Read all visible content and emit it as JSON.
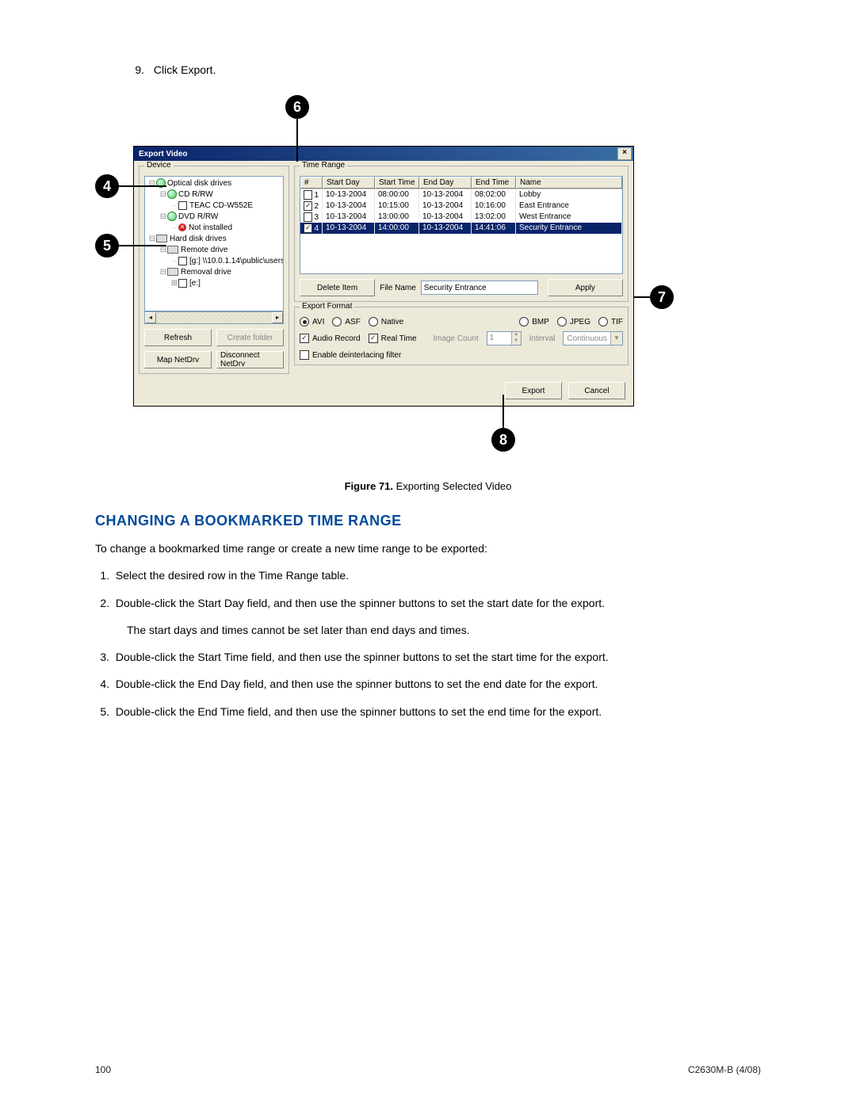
{
  "doc": {
    "step9": {
      "num": "9.",
      "text": "Click Export."
    },
    "heading": "CHANGING A BOOKMARKED TIME RANGE",
    "intro": "To change a bookmarked time range or create a new time range to be exported:",
    "steps": [
      {
        "n": "1.",
        "t": "Select the desired row in the Time Range table."
      },
      {
        "n": "2.",
        "t": "Double-click the Start Day field, and then use the spinner buttons to set the start date for the export.",
        "sub": "The start days and times cannot be set later than end days and times."
      },
      {
        "n": "3.",
        "t": "Double-click the Start Time field, and then use the spinner buttons to set the start time for the export."
      },
      {
        "n": "4.",
        "t": "Double-click the End Day field, and then use the spinner buttons to set the end date for the export."
      },
      {
        "n": "5.",
        "t": "Double-click the End Time field, and then use the spinner buttons to set the end time for the export."
      }
    ],
    "page": "100",
    "docid": "C2630M-B (4/08)"
  },
  "fig": {
    "callouts": [
      "4",
      "5",
      "6",
      "7",
      "8"
    ],
    "caption": {
      "num": "Figure 71.",
      "title": "Exporting Selected Video"
    }
  },
  "dlg": {
    "title": "Export Video",
    "close": "×",
    "device": {
      "legend": "Device",
      "tree": [
        "Optical disk drives",
        "CD R/RW",
        "TEAC    CD-W552E",
        "DVD R/RW",
        "Not installed",
        "Hard disk drives",
        "Remote drive",
        "[g:] \\\\10.0.1.14\\public\\users",
        "Removal drive",
        "[e:]"
      ],
      "buttons": {
        "refresh": "Refresh",
        "create_folder": "Create folder",
        "map": "Map NetDrv",
        "disconnect": "Disconnect NetDrv"
      }
    },
    "timerange": {
      "legend": "Time Range",
      "cols": [
        "#",
        "Start Day",
        "Start Time",
        "End Day",
        "End Time",
        "Name"
      ],
      "rows": [
        {
          "n": "1",
          "chk": false,
          "sd": "10-13-2004",
          "st": "08:00:00",
          "ed": "10-13-2004",
          "et": "08:02:00",
          "nm": "Lobby",
          "sel": false
        },
        {
          "n": "2",
          "chk": true,
          "sd": "10-13-2004",
          "st": "10:15:00",
          "ed": "10-13-2004",
          "et": "10:16:00",
          "nm": "East Entrance",
          "sel": false
        },
        {
          "n": "3",
          "chk": false,
          "sd": "10-13-2004",
          "st": "13:00:00",
          "ed": "10-13-2004",
          "et": "13:02:00",
          "nm": "West Entrance",
          "sel": false
        },
        {
          "n": "4",
          "chk": true,
          "sd": "10-13-2004",
          "st": "14:00:00",
          "ed": "10-13-2004",
          "et": "14:41:06",
          "nm": "Security Entrance",
          "sel": true
        }
      ],
      "delete": "Delete Item",
      "filename_label": "File Name",
      "filename_value": "Security Entrance",
      "apply": "Apply"
    },
    "format": {
      "legend": "Export Format",
      "radios_video": [
        {
          "l": "AVI",
          "on": true
        },
        {
          "l": "ASF",
          "on": false
        },
        {
          "l": "Native",
          "on": false
        }
      ],
      "radios_image": [
        {
          "l": "BMP",
          "on": false
        },
        {
          "l": "JPEG",
          "on": false
        },
        {
          "l": "TIF",
          "on": false
        }
      ],
      "checks": [
        {
          "l": "Audio Record",
          "on": true
        },
        {
          "l": "Real Time",
          "on": true
        }
      ],
      "image_count": {
        "label": "Image Count",
        "value": "1",
        "disabled": true
      },
      "interval": {
        "label": "Interval",
        "value": "Continuous",
        "disabled": true
      },
      "deint": {
        "label": "Enable deinterlacing filter",
        "on": false
      }
    },
    "buttons": {
      "export": "Export",
      "cancel": "Cancel"
    }
  }
}
